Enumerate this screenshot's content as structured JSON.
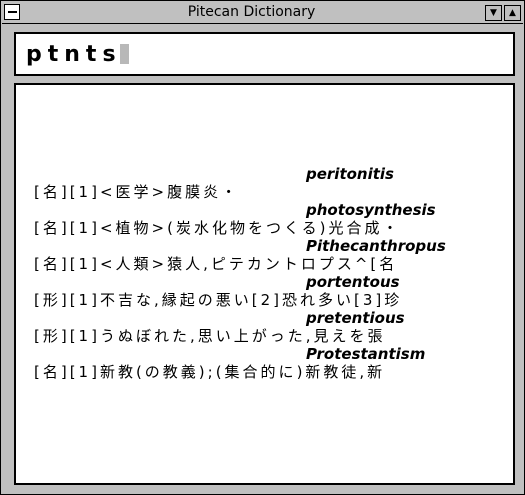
{
  "window": {
    "title": "Pitecan Dictionary",
    "minimize_glyph": "▼",
    "maximize_glyph": "▲"
  },
  "search": {
    "query": "ptnts"
  },
  "results": [
    {
      "word": "peritonitis",
      "definition": "[名][1]<医学>腹膜炎・"
    },
    {
      "word": "photosynthesis",
      "definition": "[名][1]<植物>(炭水化物をつくる)光合成・"
    },
    {
      "word": "Pithecanthropus",
      "definition": "[名][1]<人類>猿人,ピテカントロプス^[名"
    },
    {
      "word": "portentous",
      "definition": "[形][1]不吉な,縁起の悪い[2]恐れ多い[3]珍"
    },
    {
      "word": "pretentious",
      "definition": "[形][1]うぬぼれた,思い上がった,見えを張"
    },
    {
      "word": "Protestantism",
      "definition": "[名][1]新教(の教義);(集合的に)新教徒,新"
    }
  ]
}
